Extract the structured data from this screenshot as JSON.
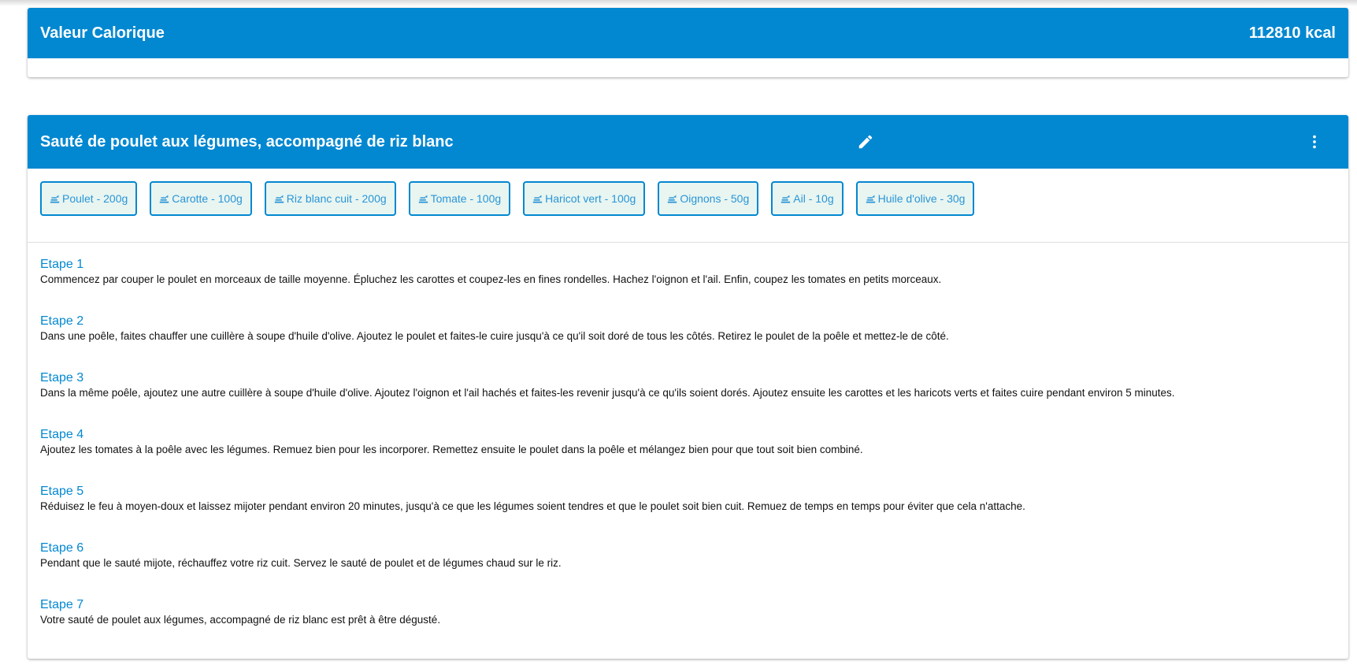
{
  "calories": {
    "title": "Valeur Calorique",
    "value": "112810 kcal"
  },
  "recipe": {
    "title": "Sauté de poulet aux légumes, accompagné de riz blanc",
    "ingredients": [
      "Poulet - 200g",
      "Carotte - 100g",
      "Riz blanc cuit - 200g",
      "Tomate - 100g",
      "Haricot vert - 100g",
      "Oignons - 50g",
      "Ail - 10g",
      "Huile d'olive - 30g"
    ],
    "steps": [
      {
        "title": "Etape 1",
        "text": "Commencez par couper le poulet en morceaux de taille moyenne. Épluchez les carottes et coupez-les en fines rondelles. Hachez l'oignon et l'ail. Enfin, coupez les tomates en petits morceaux."
      },
      {
        "title": "Etape 2",
        "text": "Dans une poêle, faites chauffer une cuillère à soupe d'huile d'olive. Ajoutez le poulet et faites-le cuire jusqu'à ce qu'il soit doré de tous les côtés. Retirez le poulet de la poêle et mettez-le de côté."
      },
      {
        "title": "Etape 3",
        "text": "Dans la même poêle, ajoutez une autre cuillère à soupe d'huile d'olive. Ajoutez l'oignon et l'ail hachés et faites-les revenir jusqu'à ce qu'ils soient dorés. Ajoutez ensuite les carottes et les haricots verts et faites cuire pendant environ 5 minutes."
      },
      {
        "title": "Etape 4",
        "text": "Ajoutez les tomates à la poêle avec les légumes. Remuez bien pour les incorporer. Remettez ensuite le poulet dans la poêle et mélangez bien pour que tout soit bien combiné."
      },
      {
        "title": "Etape 5",
        "text": "Réduisez le feu à moyen-doux et laissez mijoter pendant environ 20 minutes, jusqu'à ce que les légumes soient tendres et que le poulet soit bien cuit. Remuez de temps en temps pour éviter que cela n'attache."
      },
      {
        "title": "Etape 6",
        "text": "Pendant que le sauté mijote, réchauffez votre riz cuit. Servez le sauté de poulet et de légumes chaud sur le riz."
      },
      {
        "title": "Etape 7",
        "text": "Votre sauté de poulet aux légumes, accompagné de riz blanc est prêt à être dégusté."
      }
    ]
  },
  "icons": {
    "edit": "pencil-icon",
    "more": "more-vertical-icon",
    "ingredient": "scale-icon"
  },
  "colors": {
    "primary": "#0288d1",
    "chip_bg": "#e8f5f1"
  }
}
